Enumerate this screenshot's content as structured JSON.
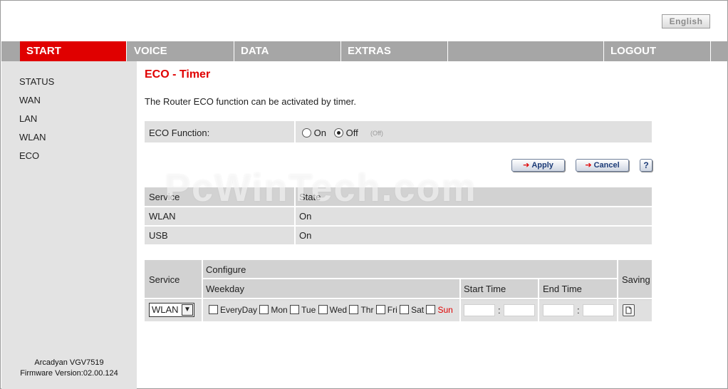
{
  "header": {
    "language_button": "English"
  },
  "nav": {
    "items": [
      {
        "label": "START"
      },
      {
        "label": "VOICE"
      },
      {
        "label": "DATA"
      },
      {
        "label": "EXTRAS"
      },
      {
        "label": ""
      },
      {
        "label": "LOGOUT"
      }
    ]
  },
  "sidebar": {
    "items": [
      {
        "label": "STATUS"
      },
      {
        "label": "WAN"
      },
      {
        "label": "LAN"
      },
      {
        "label": "WLAN"
      },
      {
        "label": "ECO"
      }
    ],
    "device_model": "Arcadyan VGV7519",
    "firmware": "Firmware Version:02.00.124"
  },
  "main": {
    "title": "ECO - Timer",
    "description": "The Router ECO function can be activated by timer.",
    "eco_function": {
      "label": "ECO Function:",
      "option_on": "On",
      "option_off": "Off",
      "selected": "Off",
      "status_hint": "(Off)"
    },
    "buttons": {
      "apply": "Apply",
      "cancel": "Cancel",
      "help": "?"
    },
    "state_table": {
      "headers": [
        "Service",
        "State"
      ],
      "rows": [
        {
          "service": "WLAN",
          "state": "On"
        },
        {
          "service": "USB",
          "state": "On"
        }
      ]
    },
    "timer_table": {
      "service_header": "Service",
      "configure_header": "Configure",
      "weekday_header": "Weekday",
      "start_header": "Start Time",
      "end_header": "End Time",
      "saving_header": "Saving",
      "service_value": "WLAN",
      "days": [
        "EveryDay",
        "Mon",
        "Tue",
        "Wed",
        "Thr",
        "Fri",
        "Sat",
        "Sun"
      ],
      "time_separator": ":"
    }
  },
  "watermark": "PcWinTech.com",
  "colors": {
    "accent": "#e00000",
    "nav_bg": "#a6a6a6",
    "sidebar_bg": "#e3e3e3",
    "row_bg": "#e0e0e0"
  }
}
